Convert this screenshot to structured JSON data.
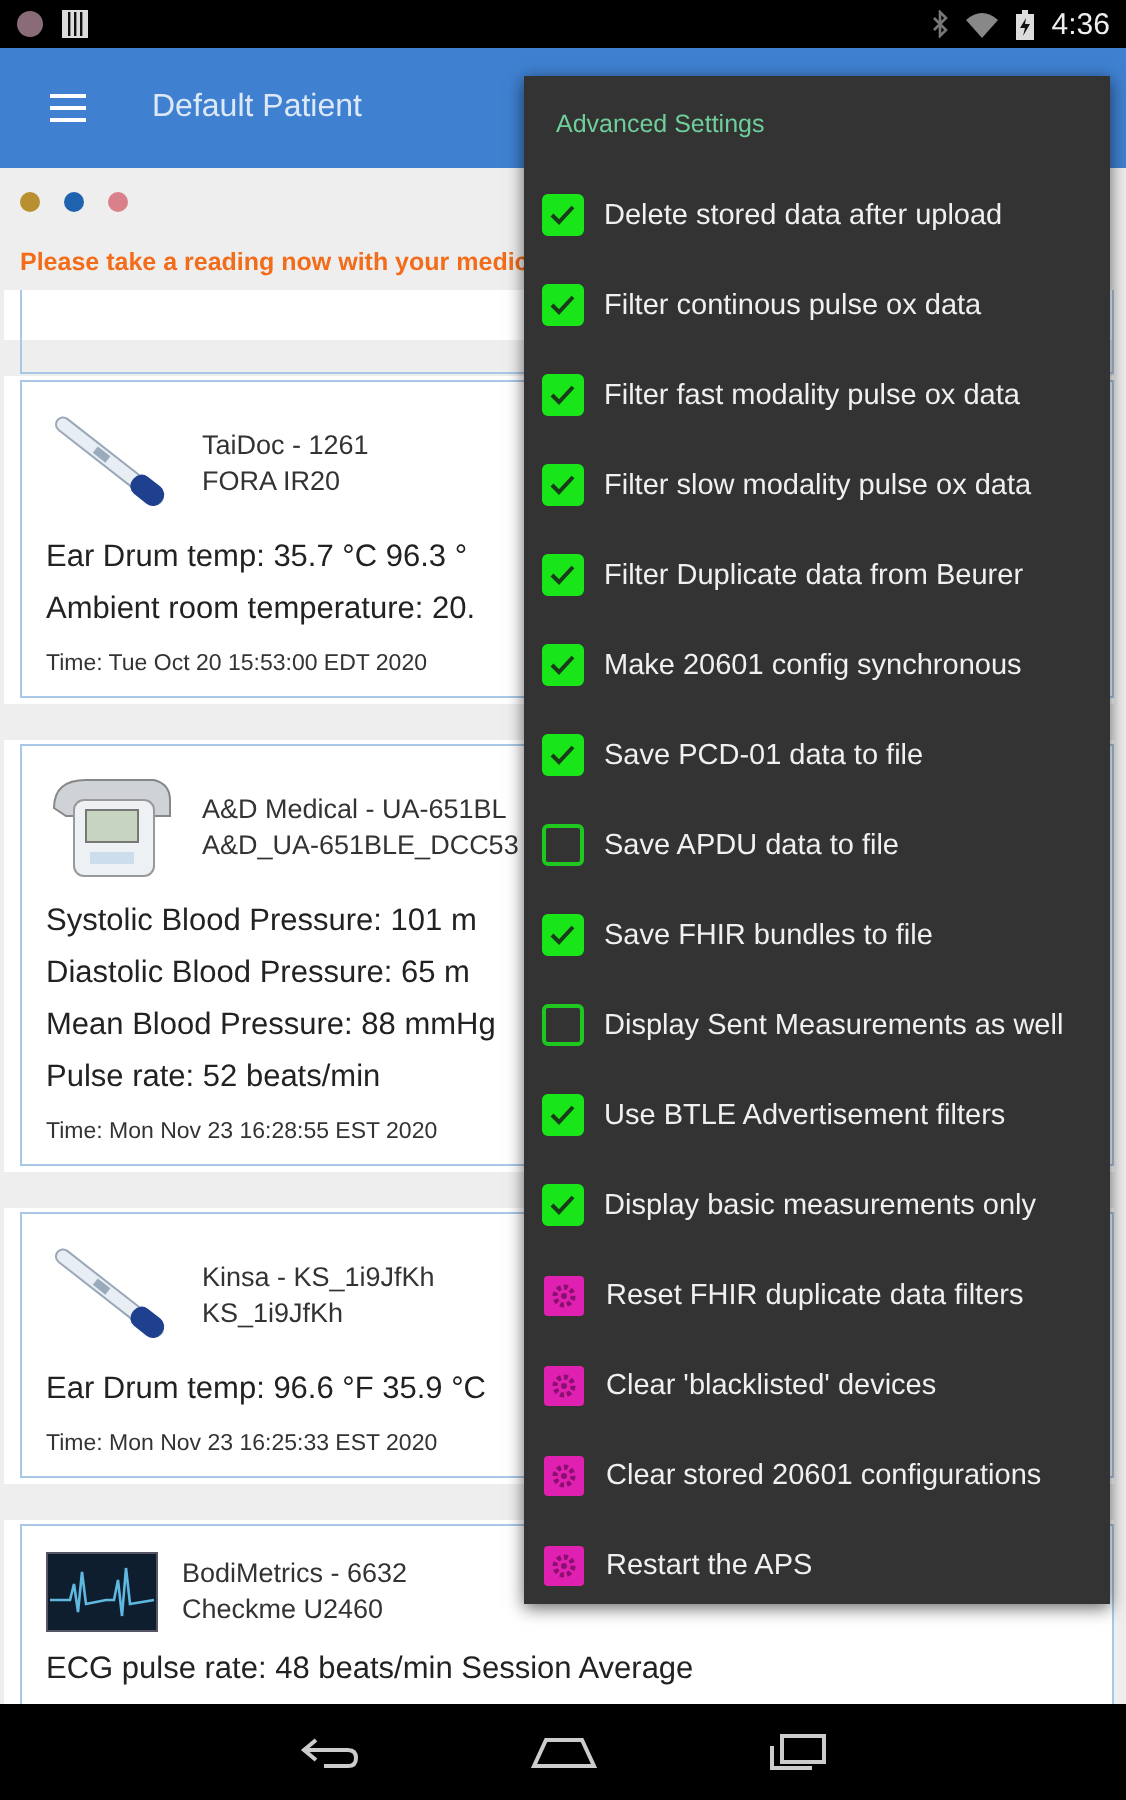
{
  "status_bar": {
    "time": "4:36"
  },
  "app_bar": {
    "title": "Default Patient"
  },
  "dots": [
    {
      "color": "#b8902f"
    },
    {
      "color": "#1f63b0"
    },
    {
      "color": "#d9808a"
    }
  ],
  "warning": "Please take a reading now with your medic",
  "cards": [
    {
      "kind": "thermometer",
      "name": "TaiDoc - 1261",
      "model": "FORA IR20",
      "lines": [
        "Ear Drum temp: 35.7 °C  96.3 °",
        "Ambient room temperature: 20."
      ],
      "time": "Time: Tue Oct 20 15:53:00 EDT 2020"
    },
    {
      "kind": "blood-pressure",
      "name": "A&D Medical  - UA-651BL",
      "model": "A&D_UA-651BLE_DCC53",
      "lines": [
        "Systolic Blood Pressure: 101 m",
        "Diastolic Blood Pressure: 65 m",
        "Mean Blood Pressure: 88 mmHg",
        "Pulse rate: 52 beats/min"
      ],
      "time": "Time: Mon Nov 23 16:28:55 EST 2020"
    },
    {
      "kind": "thermometer",
      "name": "Kinsa - KS_1i9JfKh",
      "model": "KS_1i9JfKh",
      "lines": [
        "Ear Drum temp: 96.6 °F  35.9 °C"
      ],
      "time": "Time: Mon Nov 23 16:25:33 EST 2020"
    },
    {
      "kind": "ecg",
      "name": "BodiMetrics - 6632",
      "model": "Checkme U2460",
      "lines": [
        "ECG pulse rate: 48 beats/min Session Average"
      ]
    }
  ],
  "menu": {
    "title": "Advanced Settings",
    "items": [
      {
        "kind": "checkbox",
        "label": "Delete stored data after upload",
        "checked": true
      },
      {
        "kind": "checkbox",
        "label": "Filter continous pulse ox data",
        "checked": true
      },
      {
        "kind": "checkbox",
        "label": "Filter fast modality pulse ox data",
        "checked": true
      },
      {
        "kind": "checkbox",
        "label": "Filter slow modality pulse ox data",
        "checked": true
      },
      {
        "kind": "checkbox",
        "label": "Filter Duplicate data from Beurer",
        "checked": true
      },
      {
        "kind": "checkbox",
        "label": "Make 20601 config synchronous",
        "checked": true
      },
      {
        "kind": "checkbox",
        "label": "Save PCD-01 data to file",
        "checked": true
      },
      {
        "kind": "checkbox",
        "label": "Save APDU data to file",
        "checked": false
      },
      {
        "kind": "checkbox",
        "label": "Save FHIR bundles to file",
        "checked": true
      },
      {
        "kind": "checkbox",
        "label": "Display Sent Measurements as well",
        "checked": false
      },
      {
        "kind": "checkbox",
        "label": "Use BTLE Advertisement filters",
        "checked": true
      },
      {
        "kind": "checkbox",
        "label": "Display basic measurements only",
        "checked": true
      },
      {
        "kind": "action",
        "label": "Reset FHIR duplicate data filters"
      },
      {
        "kind": "action",
        "label": "Clear 'blacklisted' devices"
      },
      {
        "kind": "action",
        "label": "Clear stored 20601 configurations"
      },
      {
        "kind": "action",
        "label": "Restart the APS"
      }
    ]
  }
}
